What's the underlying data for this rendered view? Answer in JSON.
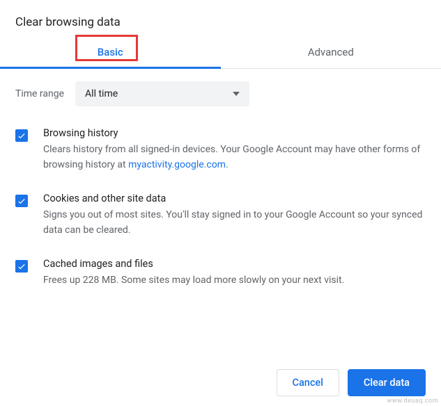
{
  "title": "Clear browsing data",
  "tabs": {
    "basic": "Basic",
    "advanced": "Advanced"
  },
  "timeRange": {
    "label": "Time range",
    "value": "All time"
  },
  "options": {
    "browsingHistory": {
      "title": "Browsing history",
      "desc_pre": "Clears history from all signed-in devices. Your Google Account may have other forms of browsing history at ",
      "link": "myactivity.google.com",
      "desc_post": "."
    },
    "cookies": {
      "title": "Cookies and other site data",
      "desc": "Signs you out of most sites. You'll stay signed in to your Google Account so your synced data can be cleared."
    },
    "cache": {
      "title": "Cached images and files",
      "desc": "Frees up 228 MB. Some sites may load more slowly on your next visit."
    }
  },
  "buttons": {
    "cancel": "Cancel",
    "clear": "Clear data"
  },
  "watermark": "www.deuaq.com"
}
